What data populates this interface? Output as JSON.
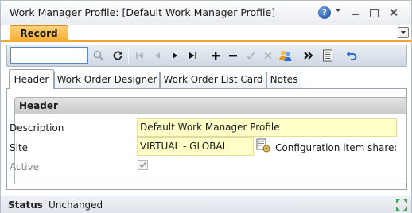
{
  "window": {
    "title": "Work Manager Profile: [Default Work Manager Profile]"
  },
  "record_tab": {
    "label": "Record"
  },
  "toolbar": {
    "search_value": "",
    "icons": [
      "search-icon",
      "refresh-icon",
      "first-icon",
      "previous-icon",
      "next-icon",
      "last-icon",
      "add-icon",
      "delete-icon",
      "save-icon",
      "cancel-icon",
      "users-icon",
      "more-icon",
      "list-icon",
      "undo-icon"
    ]
  },
  "tabs": [
    {
      "label": "Header",
      "active": true
    },
    {
      "label": "Work Order Designer",
      "active": false
    },
    {
      "label": "Work Order List Card",
      "active": false
    },
    {
      "label": "Notes",
      "active": false
    }
  ],
  "section": {
    "title": "Header",
    "description_label": "Description",
    "description_value": "Default Work Manager Profile",
    "site_label": "Site",
    "site_value": "VIRTUAL - GLOBAL",
    "site_note": "Configuration item shared by all sites",
    "active_label": "Active",
    "active_checked": true
  },
  "status": {
    "label": "Status",
    "value": "Unchanged"
  },
  "colors": {
    "record_tab": "#f6a72c",
    "field_bg": "#ffffc8",
    "accent_blue": "#1d4f9e"
  }
}
